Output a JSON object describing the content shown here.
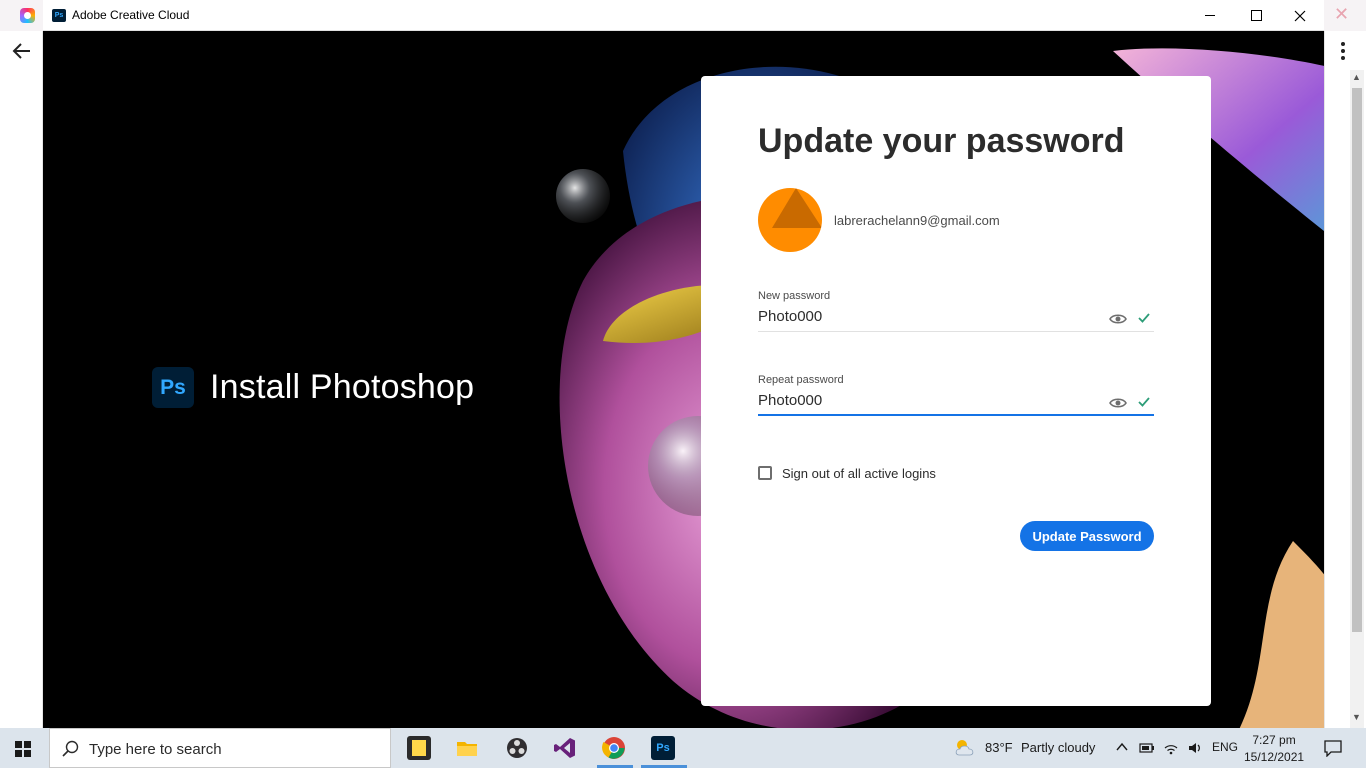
{
  "window": {
    "title": "Adobe Creative Cloud",
    "ps_mini_label": "Ps"
  },
  "left_panel": {
    "logo_text": "Ps",
    "title": "Install Photoshop"
  },
  "card": {
    "title": "Update your password",
    "email": "labrerachelann9@gmail.com",
    "new_password_label": "New password",
    "new_password_value": "Photo000",
    "repeat_password_label": "Repeat password",
    "repeat_password_value": "Photo000",
    "sign_out_label": "Sign out of all active logins",
    "sign_out_checked": false,
    "submit_label": "Update Password"
  },
  "taskbar": {
    "search_placeholder": "Type here to search",
    "weather_temp": "83°F",
    "weather_text": "Partly cloudy",
    "language": "ENG",
    "time": "7:27 pm",
    "date": "15/12/2021",
    "ps_label": "Ps"
  },
  "colors": {
    "accent": "#1473e6",
    "ps_blue": "#31a8ff",
    "ps_dark": "#001e36",
    "avatar": "#ff8c00",
    "valid_check": "#2d9d78"
  }
}
